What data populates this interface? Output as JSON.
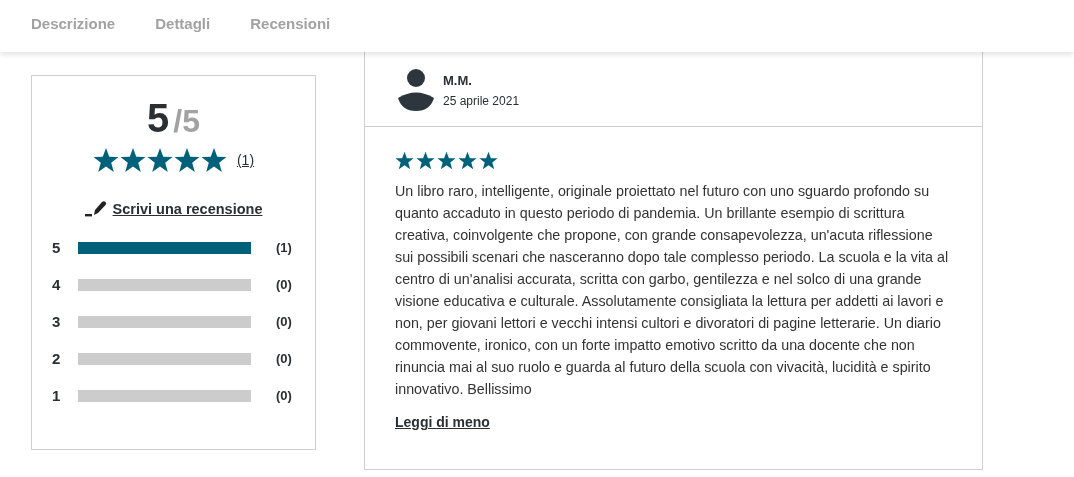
{
  "tabs": [
    {
      "label": "Descrizione"
    },
    {
      "label": "Dettagli"
    },
    {
      "label": "Recensioni"
    }
  ],
  "summary": {
    "score": "5",
    "out_of": "/5",
    "stars": 5,
    "count": "(1)",
    "write_link": "Scrivi una recensione",
    "bars": [
      {
        "label": "5",
        "level": 1,
        "count": "(1)"
      },
      {
        "label": "4",
        "level": 0,
        "count": "(0)"
      },
      {
        "label": "3",
        "level": 0,
        "count": "(0)"
      },
      {
        "label": "2",
        "level": 0,
        "count": "(0)"
      },
      {
        "label": "1",
        "level": 0,
        "count": "(0)"
      }
    ]
  },
  "review": {
    "author": "M.M.",
    "date": "25 aprile 2021",
    "stars": 5,
    "text": "Un libro raro, intelligente, originale proiettato nel futuro con uno sguardo profondo su quanto accaduto in questo periodo di pandemia. Un brillante esempio di scrittura creativa, coinvolgente che propone, con grande consapevolezza, un'acuta riflessione sui possibili scenari che nasceranno dopo tale complesso periodo. La scuola e la vita al centro di un'analisi accurata, scritta con garbo, gentilezza e nel solco di una grande visione educativa e culturale. Assolutamente consigliata la lettura per addetti ai lavori e non, per giovani lettori e vecchi intensi cultori e divoratori di pagine letterarie. Un diario commovente, ironico, con un forte impatto emotivo scritto da una docente che non rinuncia mai al suo ruolo e guarda al futuro della scuola con vivacità, lucidità e spirito innovativo. Bellissimo",
    "toggle_link": "Leggi di meno"
  }
}
